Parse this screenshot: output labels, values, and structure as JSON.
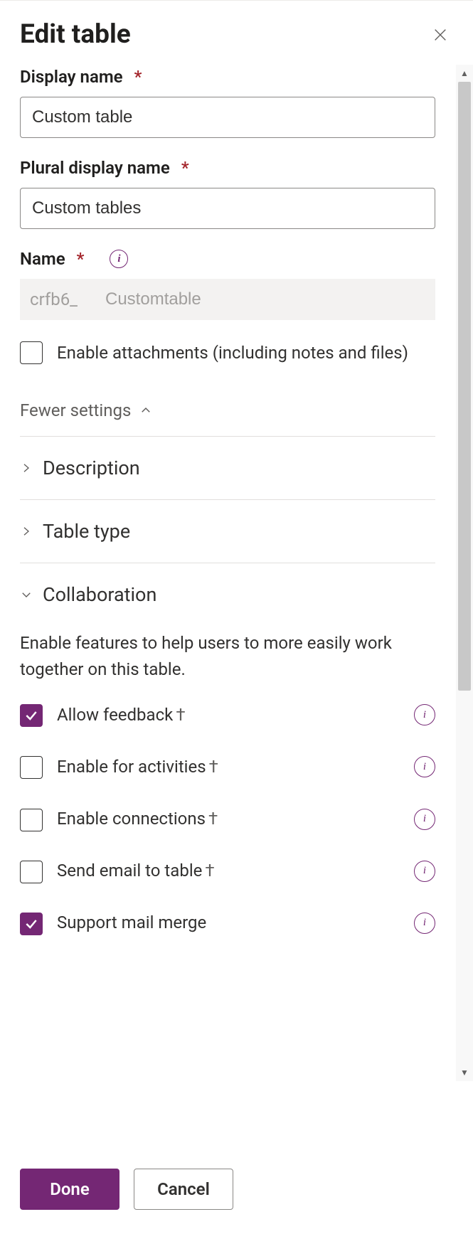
{
  "header": {
    "title": "Edit table"
  },
  "fields": {
    "displayName": {
      "label": "Display name",
      "value": "Custom table"
    },
    "pluralDisplayName": {
      "label": "Plural display name",
      "value": "Custom tables"
    },
    "name": {
      "label": "Name",
      "prefix": "crfb6_",
      "value": "Customtable"
    },
    "enableAttachments": {
      "label": "Enable attachments (including notes and files)",
      "checked": false
    }
  },
  "fewerSettingsLabel": "Fewer settings",
  "sections": {
    "description": {
      "title": "Description"
    },
    "tableType": {
      "title": "Table type"
    },
    "collaboration": {
      "title": "Collaboration",
      "description": "Enable features to help users to more easily work together on this table.",
      "items": [
        {
          "label": "Allow feedback",
          "dagger": true,
          "checked": true,
          "info": true
        },
        {
          "label": "Enable for activities",
          "dagger": true,
          "checked": false,
          "info": true
        },
        {
          "label": "Enable connections",
          "dagger": true,
          "checked": false,
          "info": true
        },
        {
          "label": "Send email to table",
          "dagger": true,
          "checked": false,
          "info": true
        },
        {
          "label": "Support mail merge",
          "dagger": false,
          "checked": true,
          "info": true
        }
      ]
    }
  },
  "footer": {
    "primary": "Done",
    "secondary": "Cancel"
  },
  "daggerChar": "†"
}
